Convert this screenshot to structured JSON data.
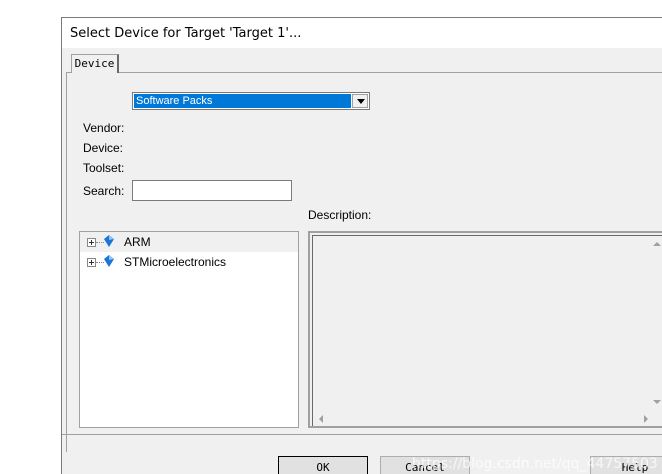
{
  "window": {
    "title": "Select Device for Target 'Target 1'..."
  },
  "tabs": [
    {
      "label": "Device"
    }
  ],
  "form": {
    "selector_value": "Software Packs",
    "vendor_label": "Vendor:",
    "device_label": "Device:",
    "toolset_label": "Toolset:",
    "search_label": "Search:",
    "search_value": "",
    "description_label": "Description:"
  },
  "tree": {
    "items": [
      {
        "label": "ARM"
      },
      {
        "label": "STMicroelectronics"
      }
    ]
  },
  "buttons": {
    "ok": "OK",
    "cancel": "Cancel",
    "help": "Help"
  },
  "watermark": "https://blog.csdn.net/qq_44757503",
  "colors": {
    "selection": "#0078d7",
    "dialog_bg": "#f0f0f0",
    "icon_blue": "#1e74d6"
  }
}
